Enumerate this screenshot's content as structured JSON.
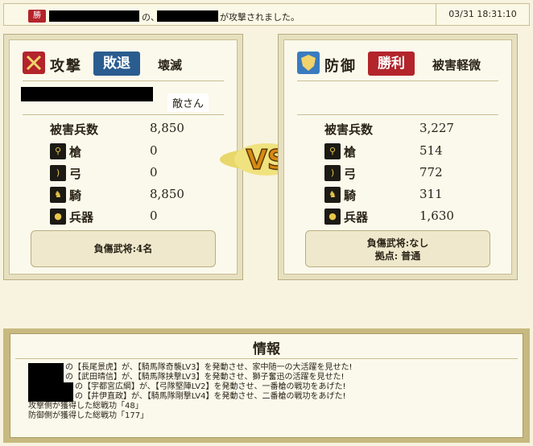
{
  "top_bar": {
    "badge": "勝",
    "particle": "の、",
    "message": "が攻撃されました。",
    "timestamp": "03/31 18:31:10"
  },
  "attacker": {
    "title": "攻撃",
    "badge": "敗退",
    "result": "壊滅",
    "honorific": "敵さん",
    "damage_label": "被害兵数",
    "damage_value": "8,850",
    "rows": [
      {
        "label": "槍",
        "value": "0",
        "icon": "spear-icon"
      },
      {
        "label": "弓",
        "value": "0",
        "icon": "bow-icon"
      },
      {
        "label": "騎",
        "value": "8,850",
        "icon": "horse-icon"
      },
      {
        "label": "兵器",
        "value": "0",
        "icon": "siege-weapon-icon"
      }
    ],
    "note": "負傷武将:4名"
  },
  "defender": {
    "title": "防御",
    "badge": "勝利",
    "result": "被害軽微",
    "damage_label": "被害兵数",
    "damage_value": "3,227",
    "rows": [
      {
        "label": "槍",
        "value": "514",
        "icon": "spear-icon"
      },
      {
        "label": "弓",
        "value": "772",
        "icon": "bow-icon"
      },
      {
        "label": "騎",
        "value": "311",
        "icon": "horse-icon"
      },
      {
        "label": "兵器",
        "value": "1,630",
        "icon": "siege-weapon-icon"
      }
    ],
    "note_line1": "負傷武将:なし",
    "note_line2": "拠点: 普通"
  },
  "vs_text": "VS",
  "info": {
    "title": "情報",
    "lines": [
      "の【長尾景虎】が、【騎馬隊奇襲LV3】を発動させ、家中随一の大活躍を見せた!",
      "の【武田晴信】が、【騎馬隊挟撃LV3】を発動させ、獅子奮迅の活躍を見せた!",
      "の【宇都宮広綱】が、【弓隊堅陣LV2】を発動させ、一番槍の戦功をあげた!",
      "の【井伊直政】が、【騎馬隊剛撃LV4】を発動させ、二番槍の戦功をあげた!",
      "攻撃側が獲得した総戦功「48」",
      "防御側が獲得した総戦功「177」"
    ]
  },
  "colors": {
    "attack_badge": "#2a5c8f",
    "defense_badge": "#b3242b",
    "panel_bg": "#fbf9ec",
    "page_bg": "#f7f3df"
  }
}
